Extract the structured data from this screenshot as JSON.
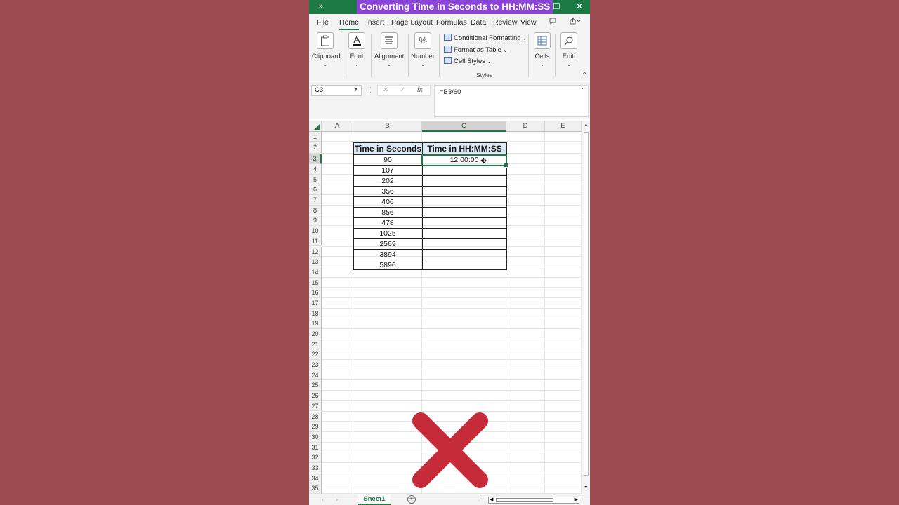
{
  "titlebar": {
    "qa_icon": "»",
    "title": "Converting Time in Seconds to HH:MM:SS",
    "restore_icon": "☐",
    "close_icon": "✕"
  },
  "tabs": [
    "File",
    "Home",
    "Insert",
    "Page Layout",
    "Formulas",
    "Data",
    "Review",
    "View"
  ],
  "active_tab": "Home",
  "ribbon": {
    "clipboard": "Clipboard",
    "font": "Font",
    "alignment": "Alignment",
    "number": "Number",
    "conditional_formatting": "Conditional Formatting",
    "format_as_table": "Format as Table",
    "cell_styles": "Cell Styles",
    "styles_group": "Styles",
    "cells": "Cells",
    "editing": "Editi"
  },
  "formula_bar": {
    "name_box": "C3",
    "formula": "=B3/60"
  },
  "columns": [
    "A",
    "B",
    "C",
    "D",
    "E"
  ],
  "selected_column": "C",
  "selected_row": 3,
  "rows": [
    "1",
    "2",
    "3",
    "4",
    "5",
    "6",
    "7",
    "8",
    "9",
    "10",
    "11",
    "12",
    "13",
    "14",
    "15",
    "16",
    "17",
    "18",
    "19",
    "20",
    "21",
    "22",
    "23",
    "24",
    "25",
    "26",
    "27",
    "28",
    "29",
    "30",
    "31",
    "32",
    "33",
    "34",
    "35"
  ],
  "table": {
    "header_b": "Time in Seconds",
    "header_c": "Time in HH:MM:SS",
    "seconds": [
      "90",
      "107",
      "202",
      "356",
      "406",
      "856",
      "478",
      "1025",
      "2569",
      "3894",
      "5896"
    ],
    "c3_value": "12:00:00"
  },
  "sheet_tab": "Sheet1",
  "colors": {
    "excel_green": "#1e7a44",
    "title_highlight": "#8a44d8",
    "background": "#9b4a50",
    "x_mark": "#c62b3a",
    "header_fill": "#dce9f5"
  }
}
